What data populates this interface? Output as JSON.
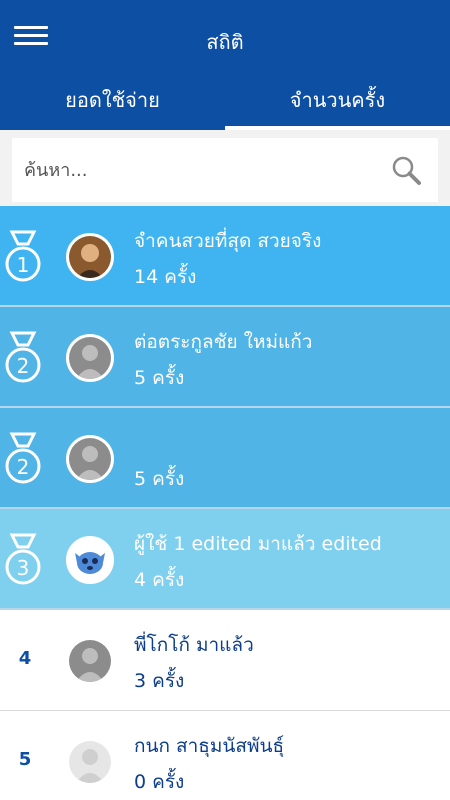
{
  "header": {
    "title": "สถิติ"
  },
  "tabs": [
    {
      "label": "ยอดใช้จ่าย",
      "active": false
    },
    {
      "label": "จำนวนครั้ง",
      "active": true
    }
  ],
  "search": {
    "placeholder": "ค้นหา...",
    "value": ""
  },
  "ranking": [
    {
      "rank": "1",
      "name": "จำคนสวยที่สุด สวยจริง",
      "count": "14  ครั้ง",
      "avatar": "user-photo"
    },
    {
      "rank": "2",
      "name": "ต่อตระกูลชัย ใหม่แก้ว",
      "count": "5  ครั้ง",
      "avatar": "default-avatar"
    },
    {
      "rank": "2",
      "name": "",
      "count": "5  ครั้ง",
      "avatar": "default-avatar"
    },
    {
      "rank": "3",
      "name": "ผู้ใช้ 1 edited มาแล้ว edited",
      "count": "4  ครั้ง",
      "avatar": "cartoon-avatar"
    },
    {
      "rank": "4",
      "name": "พี่โกโก้ มาแล้ว",
      "count": "3  ครั้ง",
      "avatar": "default-avatar"
    },
    {
      "rank": "5",
      "name": "กนก สาธุมนัสพันธุ์",
      "count": "0  ครั้ง",
      "avatar": "default-avatar"
    }
  ],
  "colors": {
    "primary": "#0d4fa3",
    "gold": "#3fb4f0",
    "silver": "#50b4e6",
    "bronze": "#7fd0ee"
  }
}
